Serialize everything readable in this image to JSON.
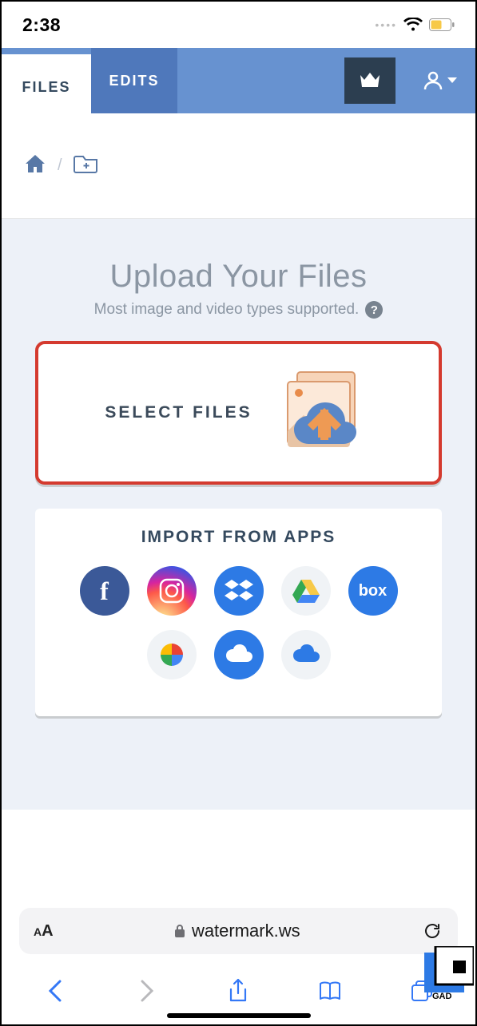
{
  "status": {
    "time": "2:38"
  },
  "header": {
    "tabs": [
      {
        "label": "FILES",
        "active": true
      },
      {
        "label": "EDITS",
        "active": false
      }
    ]
  },
  "breadcrumb": {
    "separator": "/"
  },
  "upload": {
    "title": "Upload Your Files",
    "subtitle": "Most image and video types supported.",
    "help_symbol": "?",
    "select_label": "SELECT FILES"
  },
  "import": {
    "title": "IMPORT FROM APPS",
    "apps": [
      {
        "id": "facebook",
        "label": "f"
      },
      {
        "id": "instagram",
        "label": ""
      },
      {
        "id": "dropbox",
        "label": ""
      },
      {
        "id": "google-drive",
        "label": ""
      },
      {
        "id": "box",
        "label": "box"
      },
      {
        "id": "google-photos",
        "label": ""
      },
      {
        "id": "onedrive",
        "label": ""
      },
      {
        "id": "onedrive-alt",
        "label": ""
      }
    ]
  },
  "browser": {
    "text_size_label": "AA",
    "url": "watermark.ws"
  },
  "corner_logo_text": "GAD"
}
